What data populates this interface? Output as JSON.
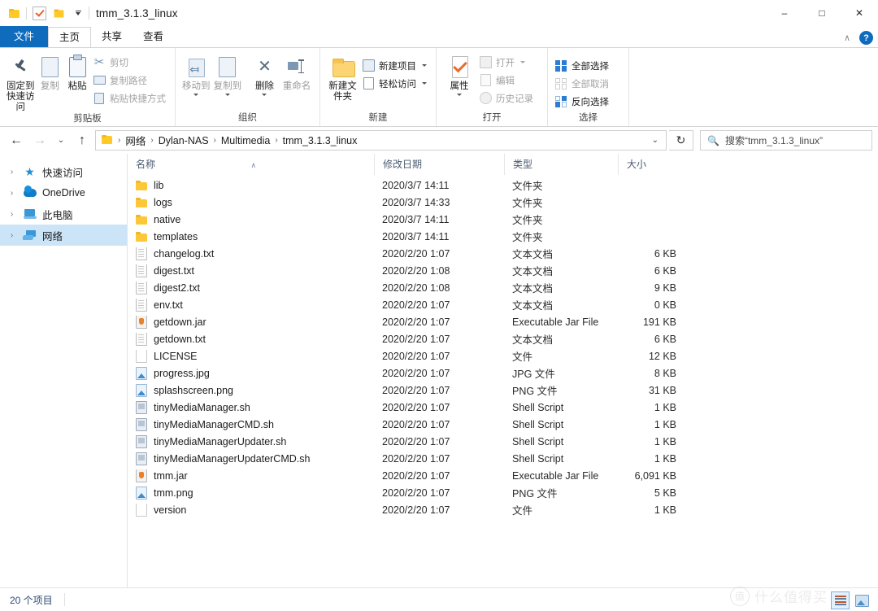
{
  "window": {
    "title": "tmm_3.1.3_linux",
    "quick_access_icons": [
      "folder-icon",
      "properties-check-icon",
      "new-folder-icon",
      "customize-qat-icon"
    ],
    "minimize_label": "–",
    "maximize_label": "□",
    "close_label": "✕",
    "collapse_ribbon_label": "∧",
    "help_label": "?"
  },
  "tabs": [
    {
      "label": "文件",
      "name": "tab-file"
    },
    {
      "label": "主页",
      "name": "tab-home"
    },
    {
      "label": "共享",
      "name": "tab-share"
    },
    {
      "label": "查看",
      "name": "tab-view"
    }
  ],
  "ribbon": {
    "groups": [
      {
        "title": "剪贴板",
        "big": [
          {
            "label": "固定到快速访问",
            "icon": "pin-icon"
          },
          {
            "label": "复制",
            "icon": "copy-icon"
          },
          {
            "label": "粘贴",
            "icon": "paste-icon"
          }
        ],
        "small": [
          {
            "label": "剪切",
            "icon": "scissors-icon"
          },
          {
            "label": "复制路径",
            "icon": "copy-path-icon"
          },
          {
            "label": "粘贴快捷方式",
            "icon": "paste-shortcut-icon"
          }
        ]
      },
      {
        "title": "组织",
        "big": [
          {
            "label": "移动到",
            "icon": "move-to-icon"
          },
          {
            "label": "复制到",
            "icon": "copy-to-icon"
          },
          {
            "label": "删除",
            "icon": "delete-icon"
          },
          {
            "label": "重命名",
            "icon": "rename-icon"
          }
        ]
      },
      {
        "title": "新建",
        "big": [
          {
            "label": "新建文件夹",
            "icon": "new-folder-icon"
          }
        ],
        "small": [
          {
            "label": "新建项目",
            "icon": "new-item-icon"
          },
          {
            "label": "轻松访问",
            "icon": "easy-access-icon"
          }
        ]
      },
      {
        "title": "打开",
        "big": [
          {
            "label": "属性",
            "icon": "properties-icon"
          }
        ],
        "small": [
          {
            "label": "打开",
            "icon": "open-icon"
          },
          {
            "label": "编辑",
            "icon": "edit-icon"
          },
          {
            "label": "历史记录",
            "icon": "history-icon"
          }
        ]
      },
      {
        "title": "选择",
        "small": [
          {
            "label": "全部选择",
            "icon": "select-all-icon"
          },
          {
            "label": "全部取消",
            "icon": "select-none-icon"
          },
          {
            "label": "反向选择",
            "icon": "invert-selection-icon"
          }
        ]
      }
    ]
  },
  "addressbar": {
    "back_label": "←",
    "forward_label": "→",
    "recent_label": "⌄",
    "up_label": "↑",
    "breadcrumbs": [
      "网络",
      "Dylan-NAS",
      "Multimedia",
      "tmm_3.1.3_linux"
    ],
    "separator": "›",
    "dropdown_label": "⌄",
    "refresh_label": "↻",
    "search_placeholder": "搜索“tmm_3.1.3_linux”"
  },
  "navpane": {
    "items": [
      {
        "label": "快速访问",
        "icon": "star-icon",
        "selected": false
      },
      {
        "label": "OneDrive",
        "icon": "cloud-icon",
        "selected": false
      },
      {
        "label": "此电脑",
        "icon": "this-pc-icon",
        "selected": false
      },
      {
        "label": "网络",
        "icon": "network-icon",
        "selected": true
      }
    ],
    "expander": "›"
  },
  "filelist": {
    "columns": [
      {
        "label": "名称",
        "name": "column-name",
        "sorted": true
      },
      {
        "label": "修改日期",
        "name": "column-date-modified",
        "sorted": false
      },
      {
        "label": "类型",
        "name": "column-type",
        "sorted": false
      },
      {
        "label": "大小",
        "name": "column-size",
        "sorted": false
      }
    ],
    "sort_glyph": "∧",
    "rows": [
      {
        "name": "lib",
        "date": "2020/3/7 14:11",
        "type": "文件夹",
        "size": "",
        "icon": "folder-icon"
      },
      {
        "name": "logs",
        "date": "2020/3/7 14:33",
        "type": "文件夹",
        "size": "",
        "icon": "folder-icon"
      },
      {
        "name": "native",
        "date": "2020/3/7 14:11",
        "type": "文件夹",
        "size": "",
        "icon": "folder-icon"
      },
      {
        "name": "templates",
        "date": "2020/3/7 14:11",
        "type": "文件夹",
        "size": "",
        "icon": "folder-icon"
      },
      {
        "name": "changelog.txt",
        "date": "2020/2/20 1:07",
        "type": "文本文档",
        "size": "6 KB",
        "icon": "text-file-icon"
      },
      {
        "name": "digest.txt",
        "date": "2020/2/20 1:08",
        "type": "文本文档",
        "size": "6 KB",
        "icon": "text-file-icon"
      },
      {
        "name": "digest2.txt",
        "date": "2020/2/20 1:08",
        "type": "文本文档",
        "size": "9 KB",
        "icon": "text-file-icon"
      },
      {
        "name": "env.txt",
        "date": "2020/2/20 1:07",
        "type": "文本文档",
        "size": "0 KB",
        "icon": "text-file-icon"
      },
      {
        "name": "getdown.jar",
        "date": "2020/2/20 1:07",
        "type": "Executable Jar File",
        "size": "191 KB",
        "icon": "jar-file-icon"
      },
      {
        "name": "getdown.txt",
        "date": "2020/2/20 1:07",
        "type": "文本文档",
        "size": "6 KB",
        "icon": "text-file-icon"
      },
      {
        "name": "LICENSE",
        "date": "2020/2/20 1:07",
        "type": "文件",
        "size": "12 KB",
        "icon": "generic-file-icon"
      },
      {
        "name": "progress.jpg",
        "date": "2020/2/20 1:07",
        "type": "JPG 文件",
        "size": "8 KB",
        "icon": "image-file-icon"
      },
      {
        "name": "splashscreen.png",
        "date": "2020/2/20 1:07",
        "type": "PNG 文件",
        "size": "31 KB",
        "icon": "image-file-icon"
      },
      {
        "name": "tinyMediaManager.sh",
        "date": "2020/2/20 1:07",
        "type": "Shell Script",
        "size": "1 KB",
        "icon": "shell-script-icon"
      },
      {
        "name": "tinyMediaManagerCMD.sh",
        "date": "2020/2/20 1:07",
        "type": "Shell Script",
        "size": "1 KB",
        "icon": "shell-script-icon"
      },
      {
        "name": "tinyMediaManagerUpdater.sh",
        "date": "2020/2/20 1:07",
        "type": "Shell Script",
        "size": "1 KB",
        "icon": "shell-script-icon"
      },
      {
        "name": "tinyMediaManagerUpdaterCMD.sh",
        "date": "2020/2/20 1:07",
        "type": "Shell Script",
        "size": "1 KB",
        "icon": "shell-script-icon"
      },
      {
        "name": "tmm.jar",
        "date": "2020/2/20 1:07",
        "type": "Executable Jar File",
        "size": "6,091 KB",
        "icon": "jar-file-icon"
      },
      {
        "name": "tmm.png",
        "date": "2020/2/20 1:07",
        "type": "PNG 文件",
        "size": "5 KB",
        "icon": "image-file-icon"
      },
      {
        "name": "version",
        "date": "2020/2/20 1:07",
        "type": "文件",
        "size": "1 KB",
        "icon": "generic-file-icon"
      }
    ]
  },
  "statusbar": {
    "item_count": "20 个项目",
    "view_details_name": "details-view-button",
    "view_tiles_name": "large-icons-view-button"
  },
  "watermark": {
    "mark": "值",
    "text": "什么值得买"
  },
  "colors": {
    "accent": "#0f6cbd",
    "selection": "#cce4f7",
    "folder_yellow": "#fcc838"
  }
}
